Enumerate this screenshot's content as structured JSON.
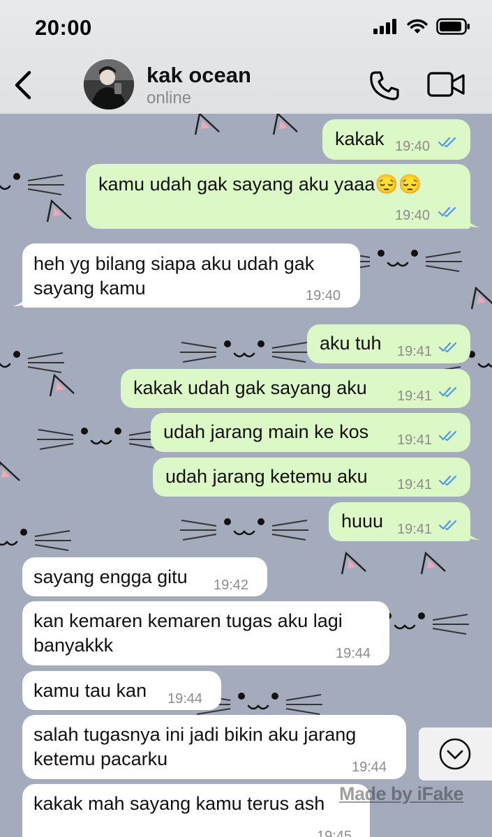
{
  "status_bar": {
    "time": "20:00"
  },
  "contact": {
    "name": "kak ocean",
    "status": "online"
  },
  "icons": {
    "back": "chevron-left-icon",
    "call": "phone-icon",
    "video": "video-camera-icon",
    "scroll": "chevron-down-icon",
    "read_ticks": "double-check-icon"
  },
  "colors": {
    "outgoing": "#dcf8c6",
    "incoming": "#ffffff",
    "ticks": "#4f97e8",
    "background": "#a3abbd"
  },
  "messages": [
    {
      "dir": "out",
      "text": "kakak",
      "time": "19:40"
    },
    {
      "dir": "out",
      "text": "kamu udah gak sayang aku yaaa😔😔",
      "time": "19:40"
    },
    {
      "dir": "in",
      "line1": "heh yg bilang siapa aku udah gak",
      "line2": "sayang kamu",
      "time": "19:40"
    },
    {
      "dir": "out",
      "text": "aku tuh",
      "time": "19:41"
    },
    {
      "dir": "out",
      "text": "kakak udah gak sayang aku",
      "time": "19:41"
    },
    {
      "dir": "out",
      "text": "udah jarang main ke kos",
      "time": "19:41"
    },
    {
      "dir": "out",
      "text": "udah jarang ketemu aku",
      "time": "19:41"
    },
    {
      "dir": "out",
      "text": "huuu",
      "time": "19:41"
    },
    {
      "dir": "in",
      "text": "sayang engga gitu",
      "time": "19:42"
    },
    {
      "dir": "in",
      "line1": "kan kemaren kemaren tugas aku lagi",
      "line2": "banyakkk",
      "time": "19:44"
    },
    {
      "dir": "in",
      "text": "kamu tau kan",
      "time": "19:44"
    },
    {
      "dir": "in",
      "line1": "salah tugasnya ini jadi bikin aku jarang",
      "line2": "ketemu pacarku",
      "time": "19:44"
    },
    {
      "dir": "in",
      "text": "kakak mah sayang kamu terus ash",
      "time": "19:45"
    }
  ],
  "watermark": "Made by iFake"
}
